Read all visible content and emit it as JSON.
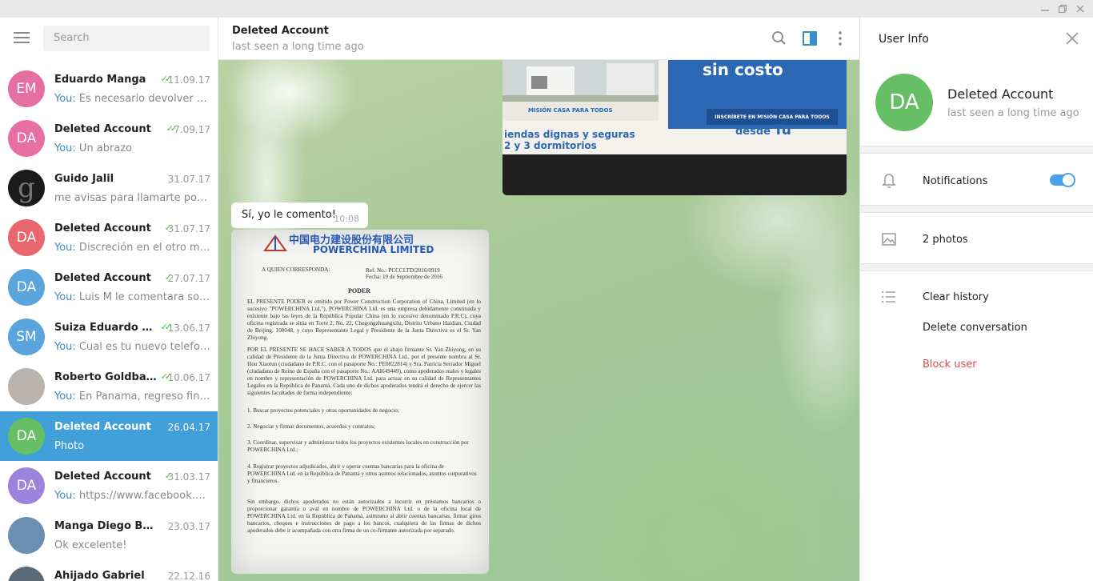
{
  "sidebar": {
    "search_placeholder": "Search",
    "chats": [
      {
        "initials": "EM",
        "color": "#e56fa3",
        "name": "Eduardo Manga",
        "date": "11.09.17",
        "read": "double",
        "you": "You:",
        "preview": " Es necesario devolver doc..."
      },
      {
        "initials": "DA",
        "color": "#e86fa4",
        "name": "Deleted Account",
        "date": "7.09.17",
        "read": "double",
        "you": "You:",
        "preview": " Un abrazo"
      },
      {
        "initials": "g",
        "color": "#1b1b1b",
        "name": "Guido Jalil",
        "date": "31.07.17",
        "read": "none",
        "you": "",
        "preview": "me avisas para llamarte por fa"
      },
      {
        "initials": "DA",
        "color": "#e8676f",
        "name": "Deleted Account",
        "date": "31.07.17",
        "read": "single",
        "you": "You:",
        "preview": " Discreción en el otro medio."
      },
      {
        "initials": "DA",
        "color": "#5aa5dc",
        "name": "Deleted Account",
        "date": "27.07.17",
        "read": "single",
        "you": "You:",
        "preview": " Luis M le comentara sobre..."
      },
      {
        "initials": "SM",
        "color": "#5aa5dc",
        "name": "Suiza Eduardo M...",
        "date": "13.06.17",
        "read": "double",
        "you": "You:",
        "preview": " Cual es tu nuevo telefono."
      },
      {
        "initials": "",
        "color": "#b8b3ac",
        "name": "Roberto Goldbau...",
        "date": "10.06.17",
        "read": "double",
        "you": "You:",
        "preview": " En Panama, regreso finale..."
      },
      {
        "initials": "DA",
        "color": "#67bf65",
        "name": "Deleted Account",
        "date": "26.04.17",
        "read": "none",
        "you": "",
        "preview": "Photo",
        "active": true
      },
      {
        "initials": "DA",
        "color": "#9c84dc",
        "name": "Deleted Account",
        "date": "31.03.17",
        "read": "single",
        "you": "You:",
        "preview": " https://www.facebook.co..."
      },
      {
        "initials": "",
        "color": "#6b8fb1",
        "name": "Manga Diego Barreiro",
        "date": "23.03.17",
        "read": "none",
        "you": "",
        "preview": "Ok excelente!"
      },
      {
        "initials": "",
        "color": "#5a6a78",
        "name": "Ahijado Gabriel",
        "date": "22.12.16",
        "read": "none",
        "you": "",
        "preview": ""
      }
    ]
  },
  "chat": {
    "title": "Deleted Account",
    "status": "last seen a long time ago",
    "photo1_texts": {
      "sin_costo": "sin costo",
      "mision": "MISIÓN CASA PARA TODOS",
      "viviendas": "iendas dignas y seguras",
      "dormitorios": "2 y 3 dormitorios",
      "inscribete": "INSCRÍBETE EN MISIÓN CASA PARA TODOS",
      "desde": "desde",
      "tu": "Tu"
    },
    "message": {
      "text": "Sí, yo le comento!",
      "time": "10:08"
    },
    "document": {
      "chinese": "中国电力建设股份有限公司",
      "company": "POWERCHINA LIMITED",
      "a_quien": "A QUIEN CORRESPONDA:",
      "ref": "Ref. No.: PCCCLTD/2016/0919",
      "fecha": "Fecha: 19 de Septiembre de 2016",
      "poder": "PODER",
      "p1": "EL PRESENTE PODER es emitido por Power Construction Corporation of China, Limited (en lo sucesivo \"POWERCHINA Ltd.\"). POWERCHINA Ltd. es una empresa debidamente constituida y existente bajo las leyes de la República Popular China (en lo sucesivo denominado P.R.C), cuya oficina registrada se sitúa en Torre 2, No. 22, Chegongzhuangxilu, Distrito Urbano Haidian, Ciudad de Beijing, 100048, y cuyo Representante Legal y Presidente de la Junta Directiva es el Sr. Yan Zhiyong.",
      "p2": "POR EL PRESENTE SE HACE SABER A TODOS que el abajo firmante Sr. Yan Zhiyong, en su calidad de Presidente de la Junta Directiva de POWERCHINA Ltd., por el presente nombra al Sr. Hou Xiaotun (ciudadano de P.R.C. con el pasaporte No.: PE0822814) y Sra. Patricia Serrador Miguel (ciudadano de Reino de España con el pasaporte No.: AAI649449), como apoderados reales y legales en nombre y representación de POWERCHINA Ltd. para actuar en su calidad de Representantes Legales en la República de Panamá. Cada uno de dichos apoderados tendrá el derecho de ejercer las siguientes facultades de forma independiente:",
      "i1": "1.   Buscar proyectos potenciales y otras oportunidades de negocio;",
      "i2": "2.   Negociar y firmar documentos, acuerdos y contratos;",
      "i3": "3.   Coordinar, supervisar y administrar todos los proyectos existentes locales en construcción por POWERCHINA Ltd.;",
      "i4": "4.   Registrar proyectos adjudicados, abrir y operar cuentas bancarias para la oficina de POWERCHINA Ltd. en la República de Panamá y otros asuntos relacionados, asuntos corporativos y financieros.",
      "p3": "Sin embargo, dichos apoderados no están autorizados a incurrir en préstamos bancarios o proporcionar garantía o aval en nombre de POWERCHINA Ltd. o de la oficina local de POWERCHINA Ltd. en la República de Panamá, asimismo al abrir cuentas bancarias, firmar giros bancarios, cheques e instrucciones de pago a los bancos, cualquiera de las firmas de dichos apoderados debe ir acompañada con otra firma de un co-firmante autorizada por separado."
    }
  },
  "user_info": {
    "title": "User Info",
    "avatar_initials": "DA",
    "avatar_color": "#67bf65",
    "name": "Deleted Account",
    "status": "last seen a long time ago",
    "notifications_label": "Notifications",
    "notifications_on": true,
    "photos_label": "2 photos",
    "clear_history": "Clear history",
    "delete_conversation": "Delete conversation",
    "block_user": "Block user",
    "accent": "#4aa0e6",
    "danger": "#d14e4e"
  }
}
